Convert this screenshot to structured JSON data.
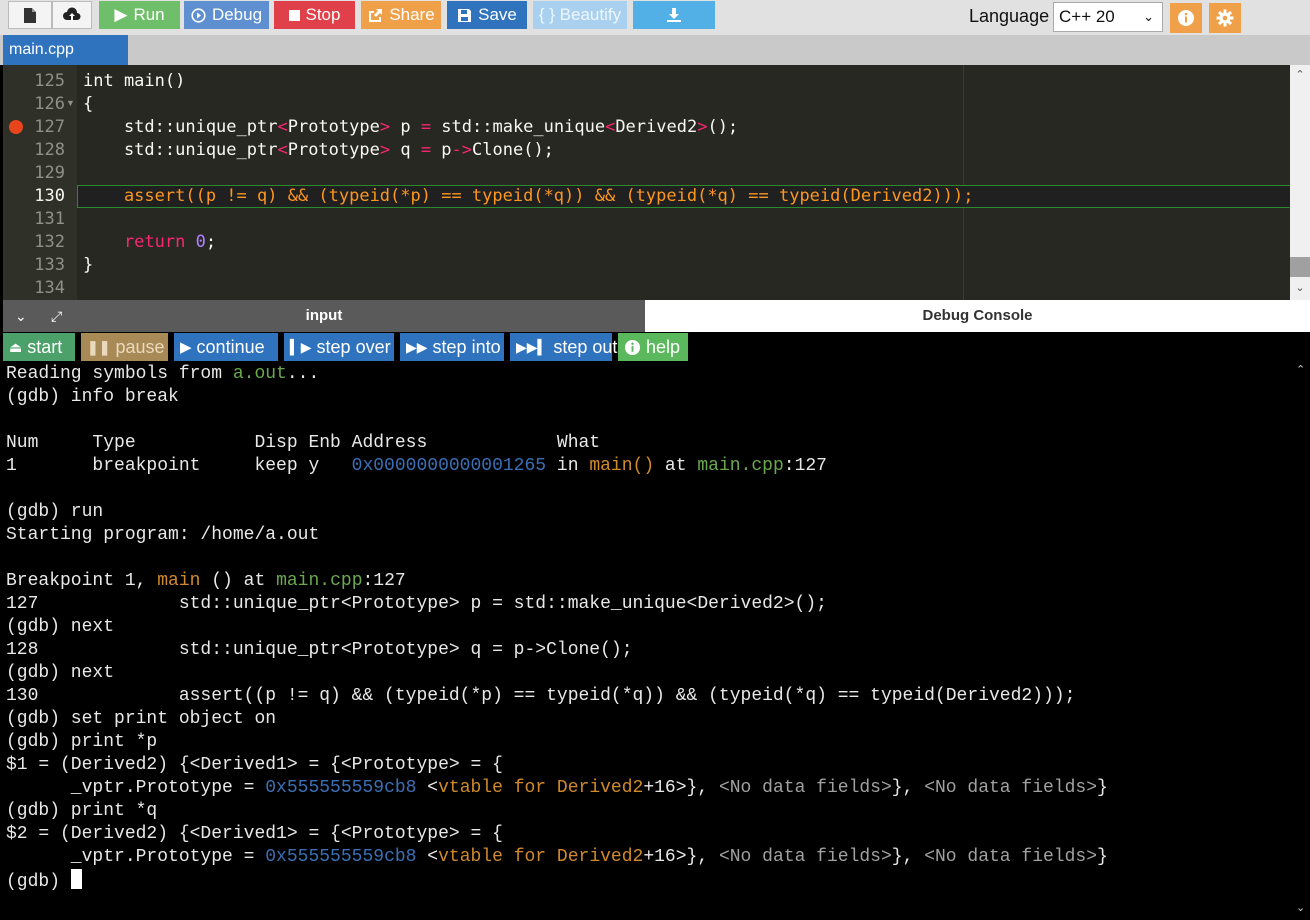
{
  "toolbar": {
    "run": "Run",
    "debug": "Debug",
    "stop": "Stop",
    "share": "Share",
    "save": "Save",
    "beautify": "{ } Beautify",
    "language_label": "Language",
    "language_value": "C++ 20"
  },
  "file_tab": "main.cpp",
  "editor": {
    "line_numbers": [
      "125",
      "126",
      "127",
      "128",
      "129",
      "130",
      "131",
      "132",
      "133",
      "134"
    ],
    "breakpoint_line": "127",
    "current_line": "130",
    "lines": {
      "l125": "int main()",
      "l126": "{",
      "l127a": "    std::unique_ptr",
      "l127b": "<",
      "l127c": "Prototype",
      "l127d": ">",
      "l127e": " p ",
      "l127f": "=",
      "l127g": " std::make_unique",
      "l127h": "<",
      "l127i": "Derived2",
      "l127j": ">",
      "l127k": "();",
      "l128a": "    std::unique_ptr",
      "l128b": "<",
      "l128c": "Prototype",
      "l128d": ">",
      "l128e": " q ",
      "l128f": "=",
      "l128g": " p",
      "l128h": "->",
      "l128i": "Clone();",
      "l130": "    assert((p != q) && (typeid(*p) == typeid(*q)) && (typeid(*q) == typeid(Derived2)));",
      "l132a": "    return ",
      "l132b": "0",
      "l132c": ";",
      "l133": "}"
    }
  },
  "io_tabs": {
    "input": "input",
    "debug_console": "Debug Console"
  },
  "debug_buttons": {
    "start": "start",
    "pause": "pause",
    "continue": "continue",
    "step_over": "step over",
    "step_into": "step into",
    "step_out": "step out",
    "help": "help"
  },
  "console": {
    "c1a": "Reading symbols from ",
    "c1b": "a.out",
    "c1c": "...",
    "c2": "(gdb) info break",
    "c4": "Num     Type           Disp Enb Address            What",
    "c5a": "1       breakpoint     keep y   ",
    "c5b": "0x0000000000001265",
    "c5c": " in ",
    "c5d": "main()",
    "c5e": " at ",
    "c5f": "main.cpp",
    "c5g": ":127",
    "c7": "(gdb) run",
    "c8": "Starting program: /home/a.out",
    "c10a": "Breakpoint 1, ",
    "c10b": "main",
    "c10c": " () at ",
    "c10d": "main.cpp",
    "c10e": ":127",
    "c11": "127             std::unique_ptr<Prototype> p = std::make_unique<Derived2>();",
    "c12": "(gdb) next",
    "c13": "128             std::unique_ptr<Prototype> q = p->Clone();",
    "c14": "(gdb) next",
    "c15": "130             assert((p != q) && (typeid(*p) == typeid(*q)) && (typeid(*q) == typeid(Derived2)));",
    "c16": "(gdb) set print object on",
    "c17": "(gdb) print *p",
    "c18": "$1 = (Derived2) {<Derived1> = {<Prototype> = {",
    "c19a": "      _vptr.Prototype = ",
    "c19b": "0x555555559cb8",
    "c19c": " <",
    "c19d": "vtable for Derived2",
    "c19e": "+16>}, ",
    "c19f": "<No data fields>",
    "c19g": "}, ",
    "c19h": "<No data fields>",
    "c19i": "}",
    "c20": "(gdb) print *q",
    "c21": "$2 = (Derived2) {<Derived1> = {<Prototype> = {",
    "c22a": "      _vptr.Prototype = ",
    "c22b": "0x555555559cb8",
    "c22c": " <",
    "c22d": "vtable for Derived2",
    "c22e": "+16>}, ",
    "c22f": "<No data fields>",
    "c22g": "}, ",
    "c22h": "<No data fields>",
    "c22i": "}",
    "c23": "(gdb) "
  },
  "colors": {
    "run": "#6fbf6a",
    "debug": "#5e8fd0",
    "stop": "#e0404a",
    "share": "#f0a048",
    "save": "#2f73bf",
    "editor_bg": "#272822",
    "console_bg": "#000000"
  }
}
